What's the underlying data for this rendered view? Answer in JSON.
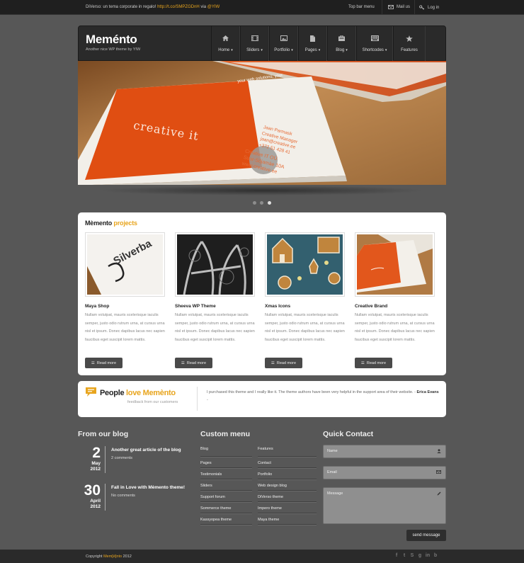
{
  "topbar": {
    "tweet_text": "DiVerso: un tema corporate in regalo!",
    "tweet_link": "http://t.co/SMPZGDnH",
    "tweet_via": "via",
    "tweet_handle": "@YIW",
    "menu_label": "Top bar menu",
    "mail_label": "Mail us",
    "login_label": "Log in"
  },
  "header": {
    "logo": "Meménto",
    "tagline": "Another nice WP theme by YIW"
  },
  "nav": [
    {
      "label": "Home",
      "icon": "home-icon",
      "dropdown": true
    },
    {
      "label": "Sliders",
      "icon": "film-icon",
      "dropdown": true
    },
    {
      "label": "Portfolio",
      "icon": "image-icon",
      "dropdown": true
    },
    {
      "label": "Pages",
      "icon": "page-icon",
      "dropdown": true
    },
    {
      "label": "Blog",
      "icon": "briefcase-icon",
      "dropdown": true
    },
    {
      "label": "Shortcodes",
      "icon": "keyboard-icon",
      "dropdown": true
    },
    {
      "label": "Features",
      "icon": "star-icon",
      "dropdown": false
    }
  ],
  "slider": {
    "card_tagline": "your web solutions, your",
    "card_brand": "creative it",
    "contact_name": "Jaan Parmask",
    "contact_role": "Creative Manager",
    "contact_email": "jaan@creative.ee",
    "contact_phone": "+372 51 428 41",
    "company": "Creative IT OÜ",
    "address": "Suur-Sõjamäe 10A",
    "website": "www.creative.ee",
    "active_slide": 3,
    "total_slides": 3
  },
  "projects": {
    "title_a": "Mèmento",
    "title_b": "projects",
    "items": [
      {
        "name": "Maya Shop",
        "thumb_text": "Silverba",
        "desc": "Nullam volutpat, mauris scelerisque iaculis semper, justo odio rutrum urna, at cursus urna nisl et ipsum. Donec dapibus lacus nec sapien faucibus eget suscipit lorem mattis.",
        "button": "Read more"
      },
      {
        "name": "Sheeva WP Theme",
        "thumb_text": "",
        "desc": "Nullam volutpat, mauris scelerisque iaculis semper, justo odio rutrum urna, at cursus urna nisl et ipsum. Donec dapibus lacus nec sapien faucibus eget suscipit lorem mattis.",
        "button": "Read more"
      },
      {
        "name": "Xmas Icons",
        "thumb_text": "",
        "desc": "Nullam volutpat, mauris scelerisque iaculis semper, justo odio rutrum urna, at cursus urna nisl et ipsum. Donec dapibus lacus nec sapien faucibus eget suscipit lorem mattis.",
        "button": "Read more"
      },
      {
        "name": "Creative Brand",
        "thumb_text": "",
        "desc": "Nullam volutpat, mauris scelerisque iaculis semper, justo odio rutrum urna, at cursus urna nisl et ipsum. Donec dapibus lacus nec sapien faucibus eget suscipit lorem mattis.",
        "button": "Read more"
      }
    ]
  },
  "testimonial": {
    "title_a": "People",
    "title_b": "love Memènto",
    "subtitle": "feedback from our customers",
    "quote": "I purchased this theme and I really like it. The theme authors have been very helpful in the support area of their website. -",
    "author": "Erica Evans",
    "author_suffix": "-"
  },
  "blog": {
    "title": "From our blog",
    "posts": [
      {
        "day": "2",
        "month": "May",
        "year": "2012",
        "title": "Another great article of the blog",
        "meta": "2 comments"
      },
      {
        "day": "30",
        "month": "April",
        "year": "2012",
        "title": "Fall in Love with Mèmento theme!",
        "meta": "No comments"
      }
    ]
  },
  "custom_menu": {
    "title": "Custom menu",
    "col1": [
      "Blog",
      "Pages",
      "Testimonials",
      "Sliders",
      "Support forum",
      "Sommerce theme",
      "Kassyopea theme"
    ],
    "col2": [
      "Features",
      "Contact",
      "Portfolio",
      "Web design blog",
      "DiVerso theme",
      "Impero theme",
      "Maya theme"
    ]
  },
  "contact": {
    "title": "Quick Contact",
    "name_placeholder": "Name",
    "email_placeholder": "Email",
    "message_placeholder": "Message",
    "send_label": "send message"
  },
  "footer": {
    "copyright_a": "Copyright",
    "brand": "Mem[è]nto",
    "copyright_b": "2012",
    "social": [
      "f",
      "t",
      "S",
      "g",
      "in",
      "b"
    ]
  },
  "colors": {
    "accent": "#e8a51e",
    "background": "#575757",
    "dark": "#2a2a2a"
  }
}
